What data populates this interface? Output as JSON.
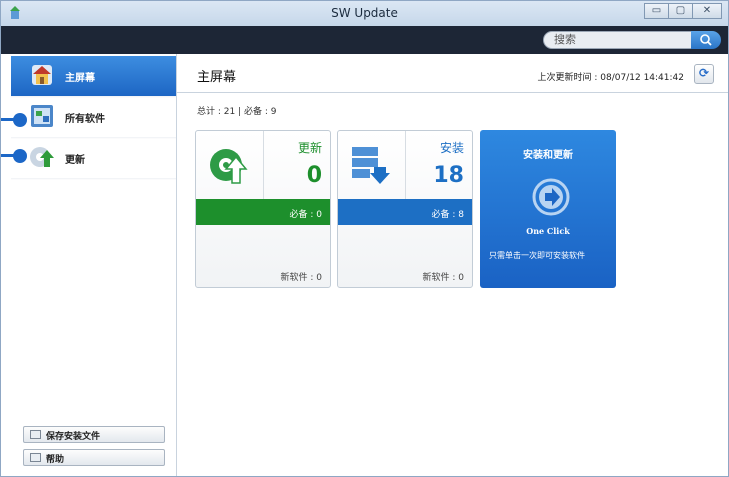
{
  "window": {
    "title": "SW Update",
    "min_label": "▭",
    "max_label": "▢",
    "close_label": "✕"
  },
  "search": {
    "placeholder": "搜索",
    "value": "搜索"
  },
  "sidebar": {
    "items": [
      {
        "label": "主屏幕",
        "active": true,
        "icon": "home-icon"
      },
      {
        "label": "所有软件",
        "active": false,
        "icon": "all-software-icon"
      },
      {
        "label": "更新",
        "active": false,
        "icon": "update-icon"
      }
    ],
    "buttons": [
      {
        "label": "保存安装文件",
        "icon": "save-icon"
      },
      {
        "label": "帮助",
        "icon": "help-icon"
      }
    ]
  },
  "main": {
    "title": "主屏幕",
    "last_update": "上次更新时间 : 08/07/12 14:41:42",
    "summary": "总计 : 21 | 必备 : 9",
    "cards": {
      "update": {
        "title": "更新",
        "count": "0",
        "required": "必备 : 0",
        "new": "新软件 : 0",
        "bar_color": "#1d8f2c",
        "title_color": "#1d8f2c"
      },
      "install": {
        "title": "安装",
        "count": "18",
        "required": "必备 : 8",
        "new": "新软件 : 0",
        "bar_color": "#1d6fc4",
        "title_color": "#1d6fc4"
      }
    },
    "promo": {
      "title": "安装和更新",
      "one_click": "One Click",
      "description": "只需单击一次即可安装软件"
    }
  },
  "colors": {
    "accent": "#1d66c4",
    "dark_bar": "#1d2636",
    "green": "#1d8f2c"
  }
}
